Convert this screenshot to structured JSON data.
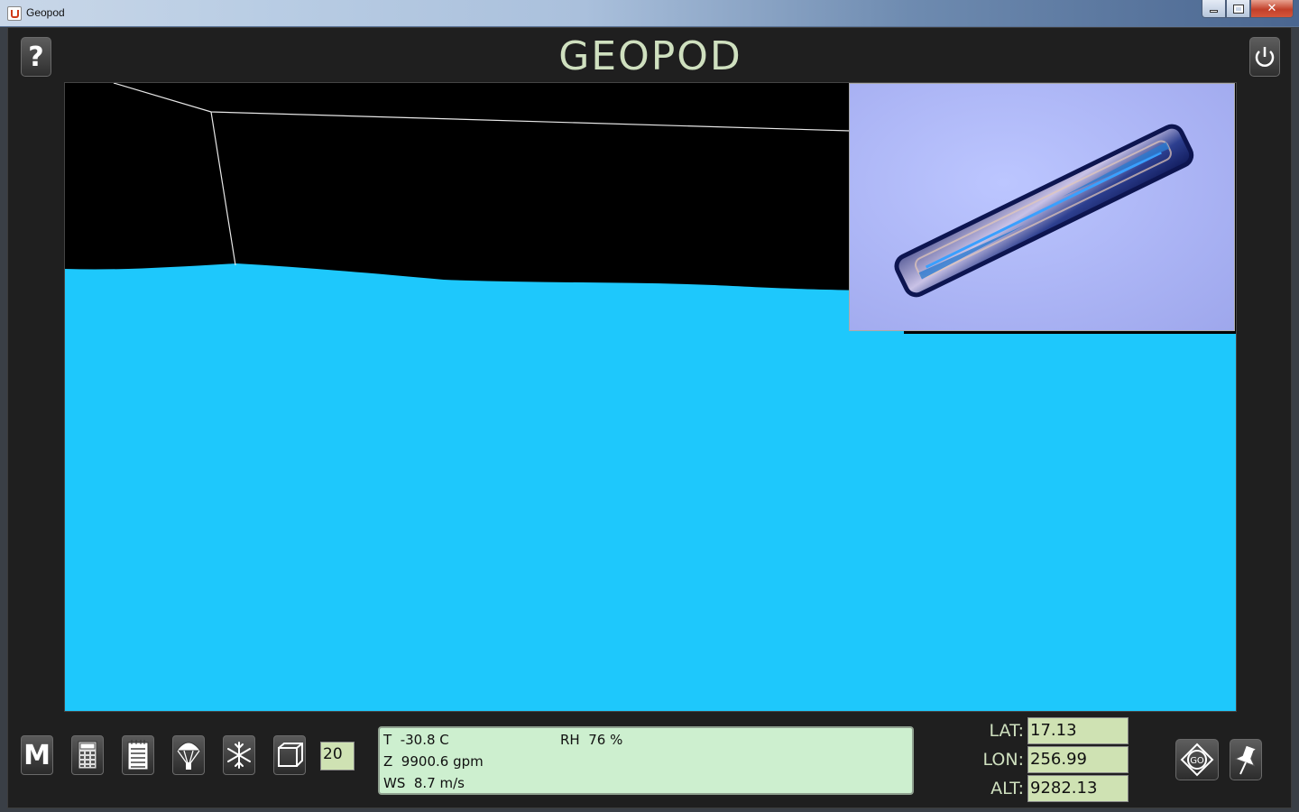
{
  "window": {
    "title": "Geopod",
    "minimize_glyph": "",
    "close_glyph": "✕"
  },
  "header": {
    "logo": "GEOPOD",
    "help_label": "?"
  },
  "viewport": {
    "sky_color": "#000000",
    "surface_color": "#1ec8fc",
    "inset_image": "ice-crystal-column"
  },
  "toolbar": {
    "menu_label": "M",
    "count_value": "20"
  },
  "readout": {
    "temperature": "T  -30.8 C",
    "humidity": "RH  76 %",
    "height": "Z  9900.6 gpm",
    "wind_speed": "WS  8.7 m/s"
  },
  "coordinates": {
    "lat_label": "LAT:",
    "lat_value": "17.13",
    "lon_label": "LON:",
    "lon_value": "256.99",
    "alt_label": "ALT:",
    "alt_value": "9282.13"
  },
  "go_button": {
    "label": "GO"
  },
  "colors": {
    "logo": "#cfe0bf",
    "field_bg": "#cfe2b3",
    "readout_bg": "#cdefcf"
  }
}
